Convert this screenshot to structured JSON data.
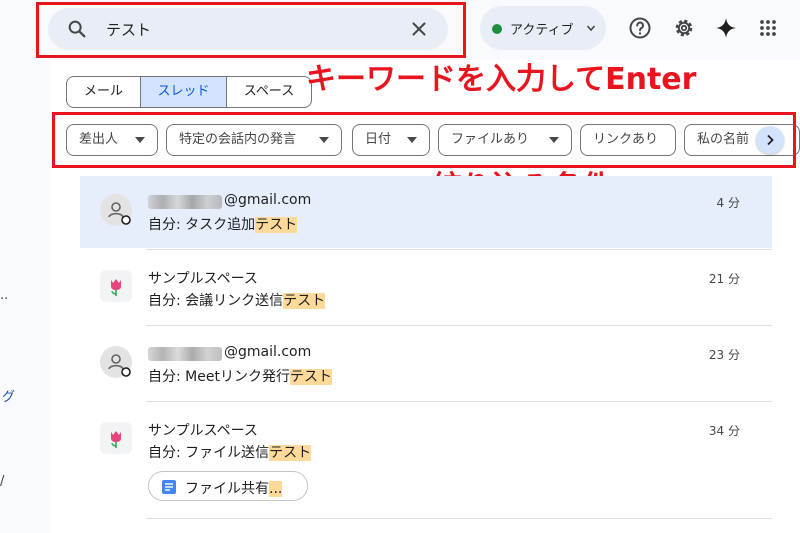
{
  "search": {
    "query": "テスト"
  },
  "status": {
    "label": "アクティブ"
  },
  "tabs": [
    {
      "label": "メール",
      "active": false
    },
    {
      "label": "スレッド",
      "active": true
    },
    {
      "label": "スペース",
      "active": false
    }
  ],
  "filters": [
    {
      "label": "差出人"
    },
    {
      "label": "特定の会話内の発言"
    },
    {
      "label": "日付"
    },
    {
      "label": "ファイルあり"
    },
    {
      "label": "リンクあり"
    },
    {
      "label": "私の名前"
    }
  ],
  "annotations": {
    "keyword": "キーワードを入力してEnter",
    "filter": "絞り込み条件",
    "color": "#e8141e"
  },
  "results": [
    {
      "title": "@gmail.com",
      "prefix": "自分: タスク追加",
      "highlight": "テスト",
      "time": "4 分",
      "type": "person"
    },
    {
      "title": "サンプルスペース",
      "prefix": "自分: 会議リンク送信",
      "highlight": "テスト",
      "time": "21 分",
      "type": "space"
    },
    {
      "title": "@gmail.com",
      "prefix": "自分: Meetリンク発行",
      "highlight": "テスト",
      "time": "23 分",
      "type": "person"
    },
    {
      "title": "サンプルスペース",
      "prefix": "自分: ファイル送信",
      "highlight": "テスト",
      "time": "34 分",
      "type": "space"
    }
  ],
  "attachment": {
    "label": "ファイル共有",
    "highlight": "..."
  },
  "left_rail": {
    "frag1": "..",
    "frag2": "グ",
    "frag3": "/"
  }
}
